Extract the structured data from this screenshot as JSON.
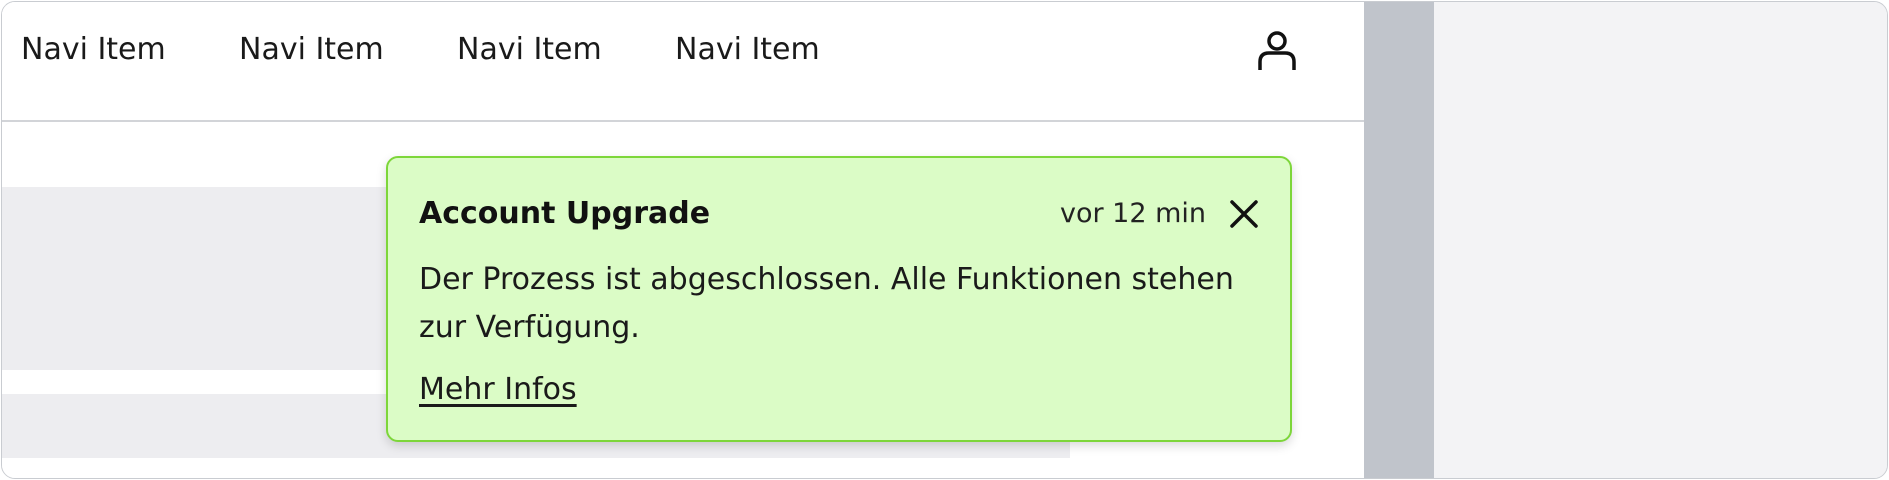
{
  "nav": {
    "items": [
      {
        "label": "Navi Item"
      },
      {
        "label": "Navi Item"
      },
      {
        "label": "Navi Item"
      },
      {
        "label": "Navi Item"
      }
    ],
    "user_icon": "user-icon"
  },
  "toast": {
    "title": "Account Upgrade",
    "time": "vor 12 min",
    "message": "Der Prozess ist abgeschlossen. Alle Funktionen stehen zur Verfügung.",
    "link": "Mehr Infos",
    "close_icon": "close-icon",
    "colors": {
      "background": "#dbfcc6",
      "border": "#7dd63a"
    }
  }
}
